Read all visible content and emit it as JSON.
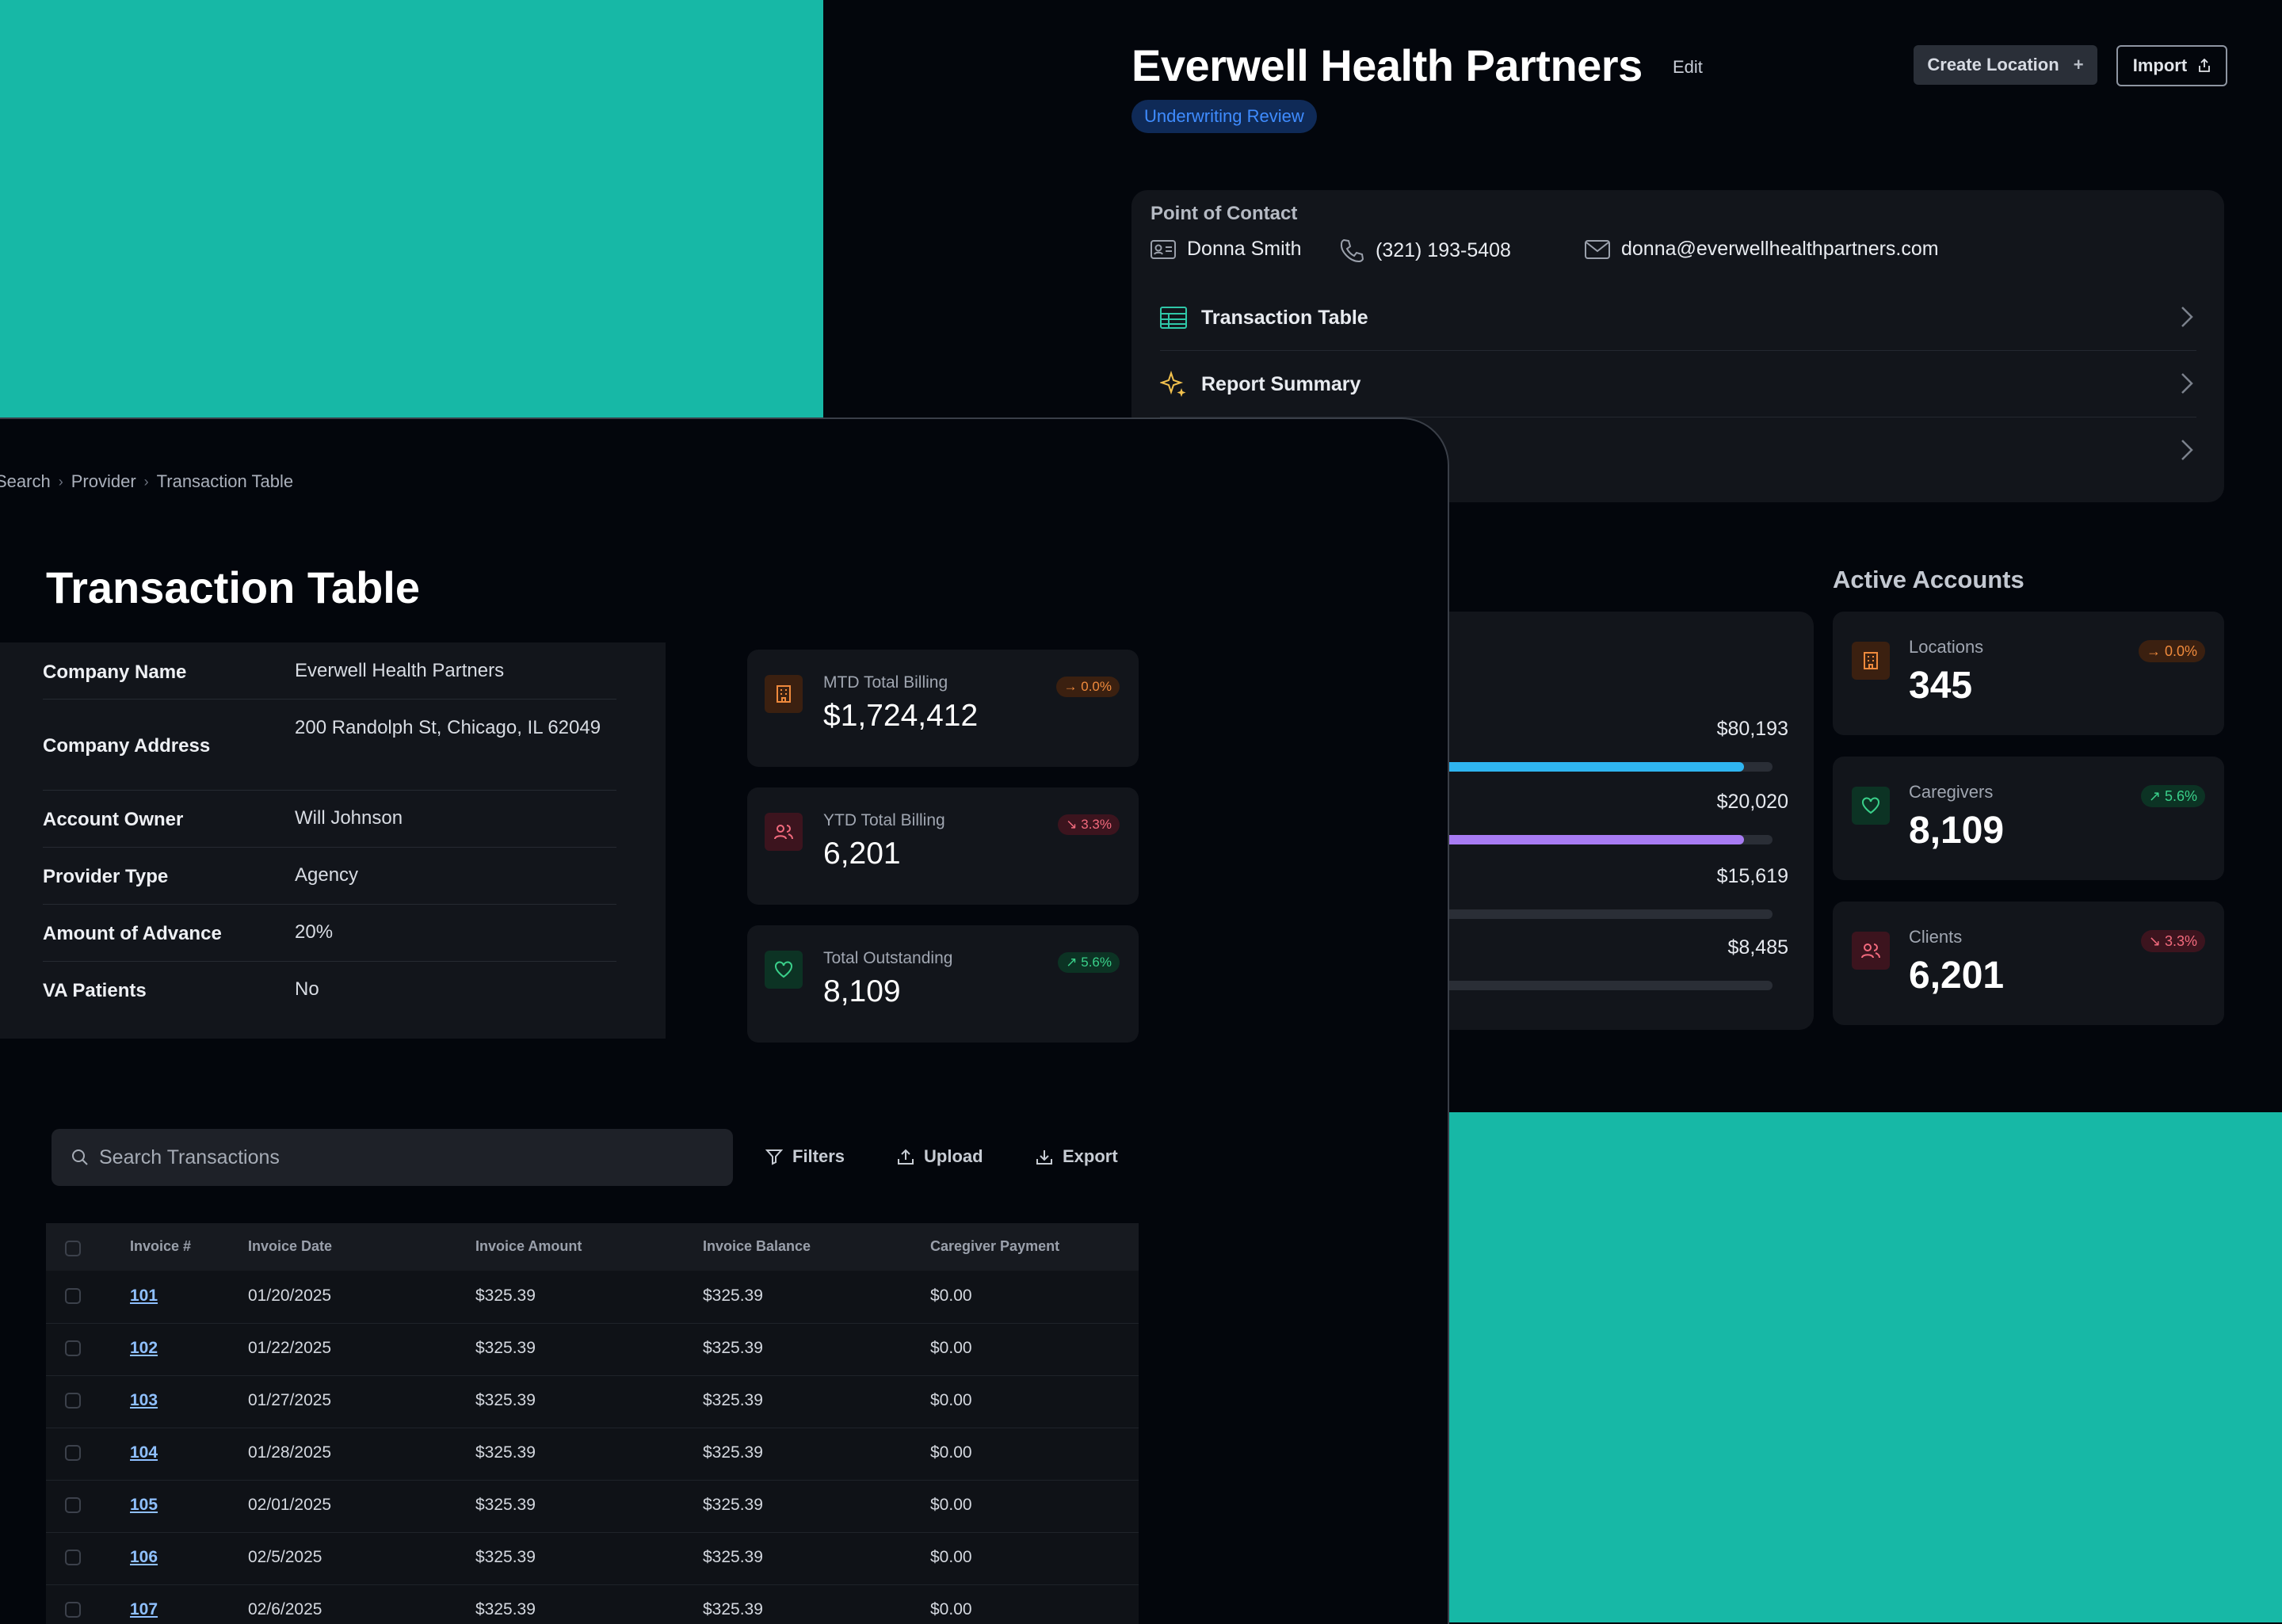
{
  "colors": {
    "teal": "#17b8a6",
    "bg": "#03060c",
    "panel": "#12151b",
    "accent_blue": "#3f8cff"
  },
  "provider": {
    "name": "Everwell Health Partners",
    "edit_label": "Edit",
    "status_badge": "Underwriting Review",
    "create_location_label": "Create Location",
    "import_label": "Import",
    "point_of_contact": {
      "label": "Point of Contact",
      "name": "Donna Smith",
      "phone": "(321) 193-5408",
      "email": "donna@everwellhealthpartners.com"
    },
    "nav": [
      {
        "label": "Transaction Table",
        "icon": "table-icon"
      },
      {
        "label": "Report Summary",
        "icon": "sparkles-icon"
      },
      {
        "label": "",
        "icon": ""
      }
    ],
    "bars": [
      {
        "value": "$80,193",
        "fill": 0.97,
        "color": "#2fb5f0"
      },
      {
        "value": "$20,020",
        "fill": 0.97,
        "color": "#a77bf3"
      },
      {
        "value": "$15,619",
        "fill": 0,
        "color": "#2a2e36"
      },
      {
        "value": "$8,485",
        "fill": 0,
        "color": "#2a2e36"
      }
    ],
    "active_accounts": {
      "title": "Active Accounts",
      "cards": [
        {
          "label": "Locations",
          "value": "345",
          "trend": "0.0%",
          "icon": "building-icon"
        },
        {
          "label": "Caregivers",
          "value": "8,109",
          "trend": "5.6%",
          "icon": "heart-icon"
        },
        {
          "label": "Clients",
          "value": "6,201",
          "trend": "3.3%",
          "icon": "users-icon"
        }
      ]
    }
  },
  "breadcrumb": [
    "Search",
    "Provider",
    "Transaction Table"
  ],
  "page_title": "Transaction Table",
  "company_info": [
    {
      "key": "Company Name",
      "value": "Everwell Health Partners"
    },
    {
      "key": "Company Address",
      "value": "200 Randolph St, Chicago, IL 62049"
    },
    {
      "key": "Account Owner",
      "value": "Will Johnson"
    },
    {
      "key": "Provider Type",
      "value": "Agency"
    },
    {
      "key": "Amount of Advance",
      "value": "20%"
    },
    {
      "key": "VA Patients",
      "value": "No"
    }
  ],
  "billing_cards": [
    {
      "label": "MTD Total Billing",
      "value": "$1,724,412",
      "trend": "0.0%",
      "icon": "building-icon"
    },
    {
      "label": "YTD Total Billing",
      "value": "6,201",
      "trend": "3.3%",
      "icon": "users-icon"
    },
    {
      "label": "Total Outstanding",
      "value": "8,109",
      "trend": "5.6%",
      "icon": "heart-icon"
    }
  ],
  "toolbar": {
    "search_placeholder": "Search Transactions",
    "filters_label": "Filters",
    "upload_label": "Upload",
    "export_label": "Export"
  },
  "table": {
    "columns": [
      "Invoice #",
      "Invoice Date",
      "Invoice Amount",
      "Invoice Balance",
      "Caregiver Payment"
    ],
    "rows": [
      [
        "101",
        "01/20/2025",
        "$325.39",
        "$325.39",
        "$0.00"
      ],
      [
        "102",
        "01/22/2025",
        "$325.39",
        "$325.39",
        "$0.00"
      ],
      [
        "103",
        "01/27/2025",
        "$325.39",
        "$325.39",
        "$0.00"
      ],
      [
        "104",
        "01/28/2025",
        "$325.39",
        "$325.39",
        "$0.00"
      ],
      [
        "105",
        "02/01/2025",
        "$325.39",
        "$325.39",
        "$0.00"
      ],
      [
        "106",
        "02/5/2025",
        "$325.39",
        "$325.39",
        "$0.00"
      ],
      [
        "107",
        "02/6/2025",
        "$325.39",
        "$325.39",
        "$0.00"
      ]
    ]
  }
}
